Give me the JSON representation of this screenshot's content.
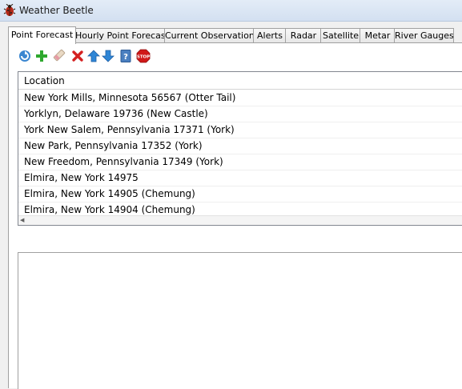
{
  "window": {
    "title": "Weather Beetle"
  },
  "tabs": [
    {
      "label": "Point Forecast",
      "active": true
    },
    {
      "label": "Hourly Point Forecast"
    },
    {
      "label": "Current Observations"
    },
    {
      "label": "Alerts"
    },
    {
      "label": "Radar"
    },
    {
      "label": "Satellite"
    },
    {
      "label": "Metar"
    },
    {
      "label": "River Gauges"
    }
  ],
  "toolbar": [
    {
      "name": "refresh-icon"
    },
    {
      "name": "add-icon"
    },
    {
      "name": "edit-icon"
    },
    {
      "name": "delete-icon"
    },
    {
      "name": "move-up-icon"
    },
    {
      "name": "move-down-icon"
    },
    {
      "name": "help-icon"
    },
    {
      "name": "stop-icon",
      "label": "STOP"
    }
  ],
  "locations": {
    "column_header": "Location",
    "rows": [
      "New York Mills, Minnesota 56567 (Otter Tail)",
      "Yorklyn, Delaware 19736 (New Castle)",
      "York New Salem, Pennsylvania 17371 (York)",
      "New Park, Pennsylvania 17352 (York)",
      "New Freedom, Pennsylvania 17349 (York)",
      "Elmira, New York 14975",
      "Elmira, New York 14905 (Chemung)",
      "Elmira, New York 14904 (Chemung)"
    ]
  },
  "colors": {
    "add": "#2ea82e",
    "delete": "#d42020",
    "arrows": "#2f86d6",
    "help": "#4a7fc0",
    "stop": "#d01818"
  }
}
